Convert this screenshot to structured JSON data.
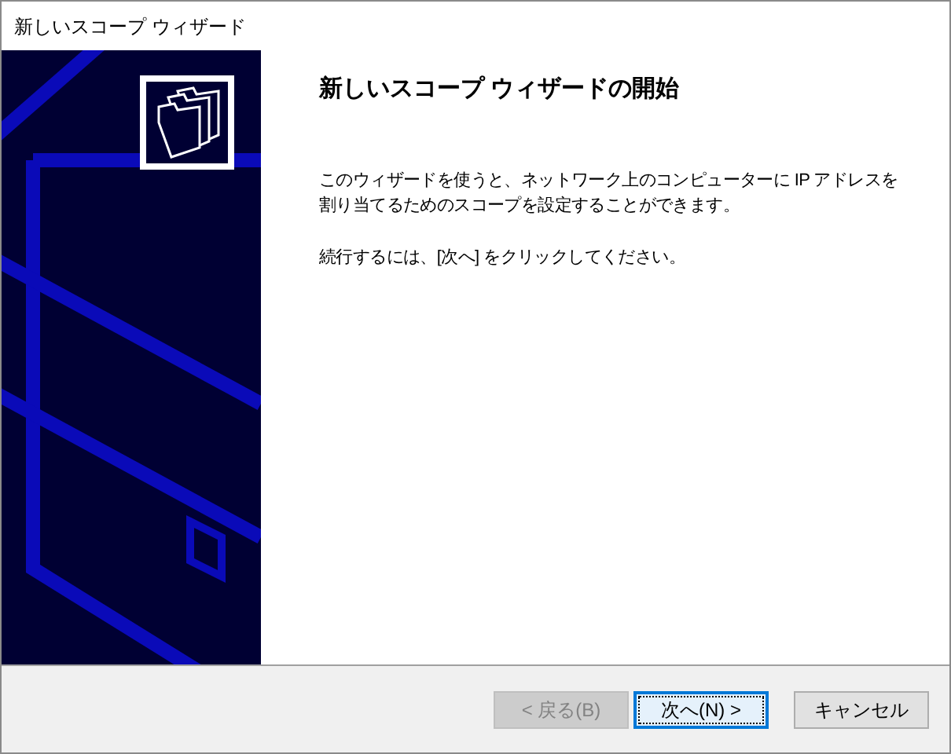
{
  "window": {
    "title": "新しいスコープ ウィザード"
  },
  "heading": "新しいスコープ ウィザードの開始",
  "paragraphs": [
    "このウィザードを使うと、ネットワーク上のコンピューターに IP アドレスを割り当てるためのスコープを設定することができます。",
    "続行するには、[次へ] をクリックしてください。"
  ],
  "buttons": [
    {
      "label": "< 戻る(B)",
      "disabled": true,
      "focused": false
    },
    {
      "label": "次へ(N) >",
      "disabled": false,
      "focused": true
    },
    {
      "label": "キャンセル",
      "disabled": false,
      "focused": false
    }
  ]
}
